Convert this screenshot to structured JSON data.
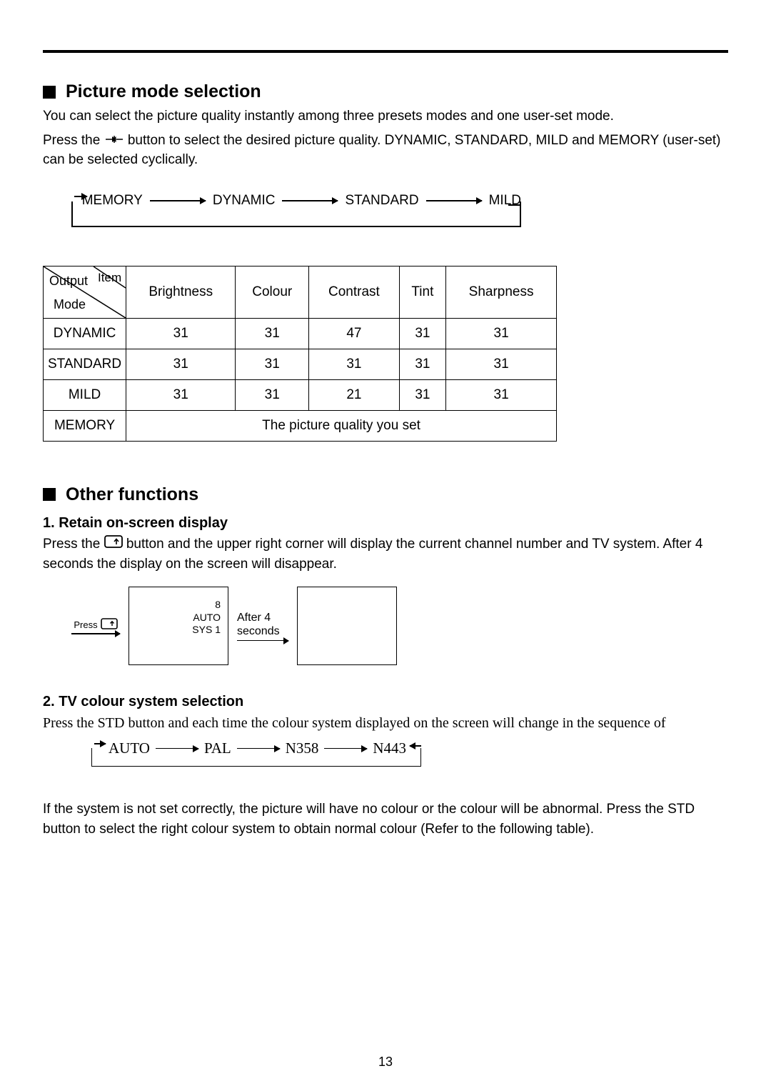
{
  "section1": {
    "heading": "Picture mode selection",
    "para1": "You can select the picture quality instantly among three presets modes and one user-set mode.",
    "para2a": "Press the",
    "para2b": "button to select the desired picture quality. DYNAMIC, STANDARD, MILD and MEMORY (user-set) can be selected cyclically.",
    "cycle": [
      "MEMORY",
      "DYNAMIC",
      "STANDARD",
      "MILD"
    ]
  },
  "table": {
    "diag": {
      "output": "Output",
      "item": "Item",
      "mode": "Mode"
    },
    "cols": [
      "Brightness",
      "Colour",
      "Contrast",
      "Tint",
      "Sharpness"
    ],
    "rows": [
      {
        "mode": "DYNAMIC",
        "vals": [
          "31",
          "31",
          "47",
          "31",
          "31"
        ]
      },
      {
        "mode": "STANDARD",
        "vals": [
          "31",
          "31",
          "31",
          "31",
          "31"
        ]
      },
      {
        "mode": "MILD",
        "vals": [
          "31",
          "31",
          "21",
          "31",
          "31"
        ]
      }
    ],
    "memory_label": "MEMORY",
    "memory_text": "The picture quality you set"
  },
  "section2": {
    "heading": "Other functions",
    "f1": {
      "title": "1. Retain on-screen display",
      "text_a": "Press the",
      "text_b": "button and the upper right corner will display the current channel number and TV system. After 4 seconds the display on the screen will disappear.",
      "press_label": "Press",
      "osd_lines": [
        "8",
        "AUTO",
        "SYS 1"
      ],
      "after_l1": "After 4",
      "after_l2": "seconds"
    },
    "f2": {
      "title": "2. TV colour system selection",
      "text": "Press the STD button and each time the colour system displayed on the screen will change in the sequence of",
      "cycle": [
        "AUTO",
        "PAL",
        "N358",
        "N443"
      ],
      "note": "If the system is not set correctly, the picture will have no colour or the colour will be abnormal. Press the STD button to select the right colour system to obtain normal colour (Refer to the following table)."
    }
  },
  "page_number": "13"
}
